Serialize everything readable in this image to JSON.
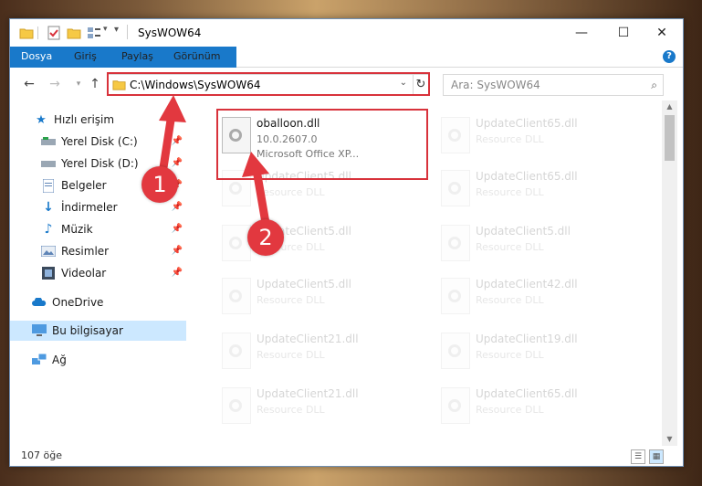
{
  "window": {
    "title": "SysWOW64",
    "controls": {
      "minimize": "—",
      "maximize": "☐",
      "close": "✕"
    }
  },
  "ribbon": {
    "tabs": [
      "Dosya",
      "Giriş",
      "Paylaş",
      "Görünüm"
    ],
    "help": "?"
  },
  "address_bar": {
    "path": "C:\\Windows\\SysWOW64",
    "refresh_icon": "↻"
  },
  "search": {
    "placeholder": "Ara: SysWOW64",
    "icon": "search-icon"
  },
  "sidebar": {
    "items": [
      {
        "label": "Hızlı erişim",
        "icon": "star-icon",
        "pinned": false
      },
      {
        "label": "Yerel Disk (C:)",
        "icon": "drive-icon",
        "pinned": true
      },
      {
        "label": "Yerel Disk (D:)",
        "icon": "drive-icon",
        "pinned": true
      },
      {
        "label": "Belgeler",
        "icon": "documents-icon",
        "pinned": true
      },
      {
        "label": "İndirmeler",
        "icon": "download-icon",
        "pinned": true
      },
      {
        "label": "Müzik",
        "icon": "music-icon",
        "pinned": true
      },
      {
        "label": "Resimler",
        "icon": "pictures-icon",
        "pinned": true
      },
      {
        "label": "Videolar",
        "icon": "video-icon",
        "pinned": true
      },
      {
        "label": "OneDrive",
        "icon": "cloud-icon",
        "pinned": false
      },
      {
        "label": "Bu bilgisayar",
        "icon": "computer-icon",
        "pinned": false,
        "selected": true
      },
      {
        "label": "Ağ",
        "icon": "network-icon",
        "pinned": false
      }
    ]
  },
  "files": {
    "highlighted": {
      "name": "oballoon.dll",
      "version": "10.0.2607.0",
      "description": "Microsoft Office XP..."
    },
    "col1": [
      {
        "name": "UpdateClient5.dll",
        "type": "Resource DLL"
      },
      {
        "name": "UpdateClient5.dll",
        "type": "Resource DLL"
      },
      {
        "name": "UpdateClient5.dll",
        "type": "Resource DLL"
      },
      {
        "name": "UpdateClient21.dll",
        "type": "Resource DLL"
      },
      {
        "name": "UpdateClient21.dll",
        "type": "Resource DLL"
      }
    ],
    "col2": [
      {
        "name": "UpdateClient65.dll",
        "type": "Resource DLL"
      },
      {
        "name": "UpdateClient65.dll",
        "type": "Resource DLL"
      },
      {
        "name": "UpdateClient5.dll",
        "type": "Resource DLL"
      },
      {
        "name": "UpdateClient42.dll",
        "type": "Resource DLL"
      },
      {
        "name": "UpdateClient19.dll",
        "type": "Resource DLL"
      },
      {
        "name": "UpdateClient65.dll",
        "type": "Resource DLL"
      }
    ]
  },
  "status": {
    "item_count": "107 öğe"
  },
  "annotations": {
    "step1": "1",
    "step2": "2"
  },
  "colors": {
    "accent": "#1979ca",
    "highlight": "#d8323b",
    "selected": "#cce8ff"
  }
}
